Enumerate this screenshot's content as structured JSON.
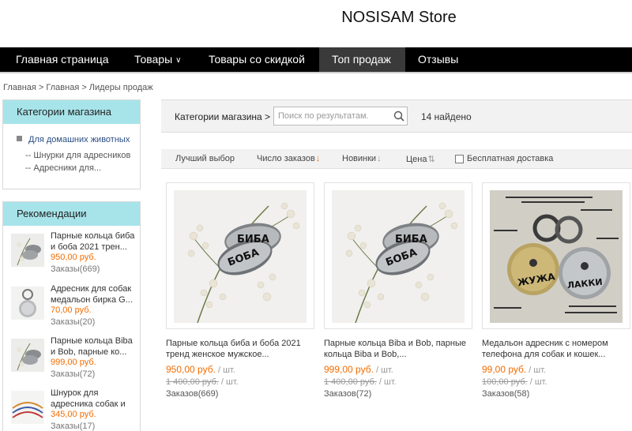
{
  "header": {
    "store_title": "NOSISAM Store"
  },
  "nav": {
    "items": [
      {
        "label": "Главная страница"
      },
      {
        "label": "Товары"
      },
      {
        "label": "Товары со скидкой"
      },
      {
        "label": "Топ продаж"
      },
      {
        "label": "Отзывы"
      }
    ]
  },
  "breadcrumb": "Главная > Главная > Лидеры продаж",
  "sidebar": {
    "categories": {
      "title": "Категории магазина",
      "main": "Для домашних животных",
      "subs": [
        "Шнурки для адресников",
        "Адресники для..."
      ]
    },
    "recommendations": {
      "title": "Рекомендации",
      "items": [
        {
          "title": "Парные кольца биба и боба 2021 трен...",
          "price": "950,00 руб.",
          "orders": "Заказы(669)"
        },
        {
          "title": "Адресник для собак медальон бирка G...",
          "price": "70,00 руб.",
          "orders": "Заказы(20)"
        },
        {
          "title": "Парные кольца Biba и Bob, парные ко...",
          "price": "999,00 руб.",
          "orders": "Заказы(72)"
        },
        {
          "title": "Шнурок для адресника собак и",
          "price": "345,00 руб.",
          "orders": "Заказы(17)"
        }
      ]
    }
  },
  "search": {
    "label": "Категории магазина >",
    "placeholder": "Поиск по результатам.",
    "found": "14 найдено"
  },
  "sort": {
    "best": "Лучший выбор",
    "orders": "Число заказов",
    "new": "Новинки",
    "price": "Цена",
    "free_shipping": "Бесплатная доставка"
  },
  "products": [
    {
      "title": "Парные кольца биба и боба 2021 тренд женское мужское...",
      "price": "950,00 руб.",
      "unit": " / шт.",
      "old_price": "1 400,00 руб.",
      "orders": "Заказов(669)"
    },
    {
      "title": "Парные кольца Biba и Bob, парные кольца Biba и Bob,...",
      "price": "999,00 руб.",
      "unit": " / шт.",
      "old_price": "1 400,00 руб.",
      "orders": "Заказов(72)"
    },
    {
      "title": "Медальон адресник с номером телефона для собак и кошек...",
      "price": "99,00 руб.",
      "unit": " / шт.",
      "old_price": "100,00 руб.",
      "orders": "Заказов(58)"
    }
  ],
  "ring_text": {
    "biba": "БИБА",
    "boba": "БОБА",
    "zhuzha": "ЖУЖА",
    "lucky": "ЛАККИ"
  },
  "colors": {
    "accent": "#f36c00",
    "nav_bg": "#000000",
    "sidebar_head": "#a7e4ea"
  }
}
